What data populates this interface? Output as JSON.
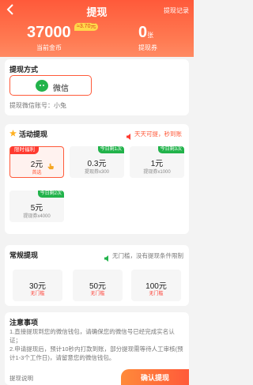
{
  "header": {
    "title": "提现",
    "record_link": "提现记录",
    "coins": "37000",
    "coins_pill": "≈3.70元",
    "coins_label": "当前金币",
    "vouchers": "0",
    "vouchers_unit": "张",
    "vouchers_label": "提现券"
  },
  "payment": {
    "title": "提现方式",
    "method": "微信",
    "account_label": "提现微信账号：小兔"
  },
  "activity": {
    "title": "活动提现",
    "note": "天天可提，秒到账",
    "options": [
      {
        "badge": "限时福利",
        "amount": "2元",
        "sub": "首选",
        "selected": true
      },
      {
        "badge": "今日剩1次",
        "amount": "0.3元",
        "sub": "提现券x300"
      },
      {
        "badge": "今日剩3次",
        "amount": "1元",
        "sub": "提现券x1000"
      },
      {
        "badge": "今日剩2次",
        "amount": "5元",
        "sub": "提现券x4000"
      }
    ]
  },
  "normal": {
    "title": "常规提现",
    "note": "无门槛，没有提现条件限制",
    "options": [
      {
        "amount": "30元",
        "sub": "无门槛"
      },
      {
        "amount": "50元",
        "sub": "无门槛"
      },
      {
        "amount": "100元",
        "sub": "无门槛"
      }
    ]
  },
  "notes": {
    "title": "注意事项",
    "line1": "1.直接提现到您的微信钱包，请确保您的微信号已经完成实名认证；",
    "line2": "2.申请提现后，预计10秒内打款到账，部分提现需等待人工审核(预计1-3个工作日)，请留意您的微信钱包。",
    "line3": "提现说明",
    "button": "确认提现"
  },
  "colors": {
    "accent": "#ff5a3a",
    "wechat_green": "#22b34b",
    "badge_red": "#ff3b30"
  }
}
